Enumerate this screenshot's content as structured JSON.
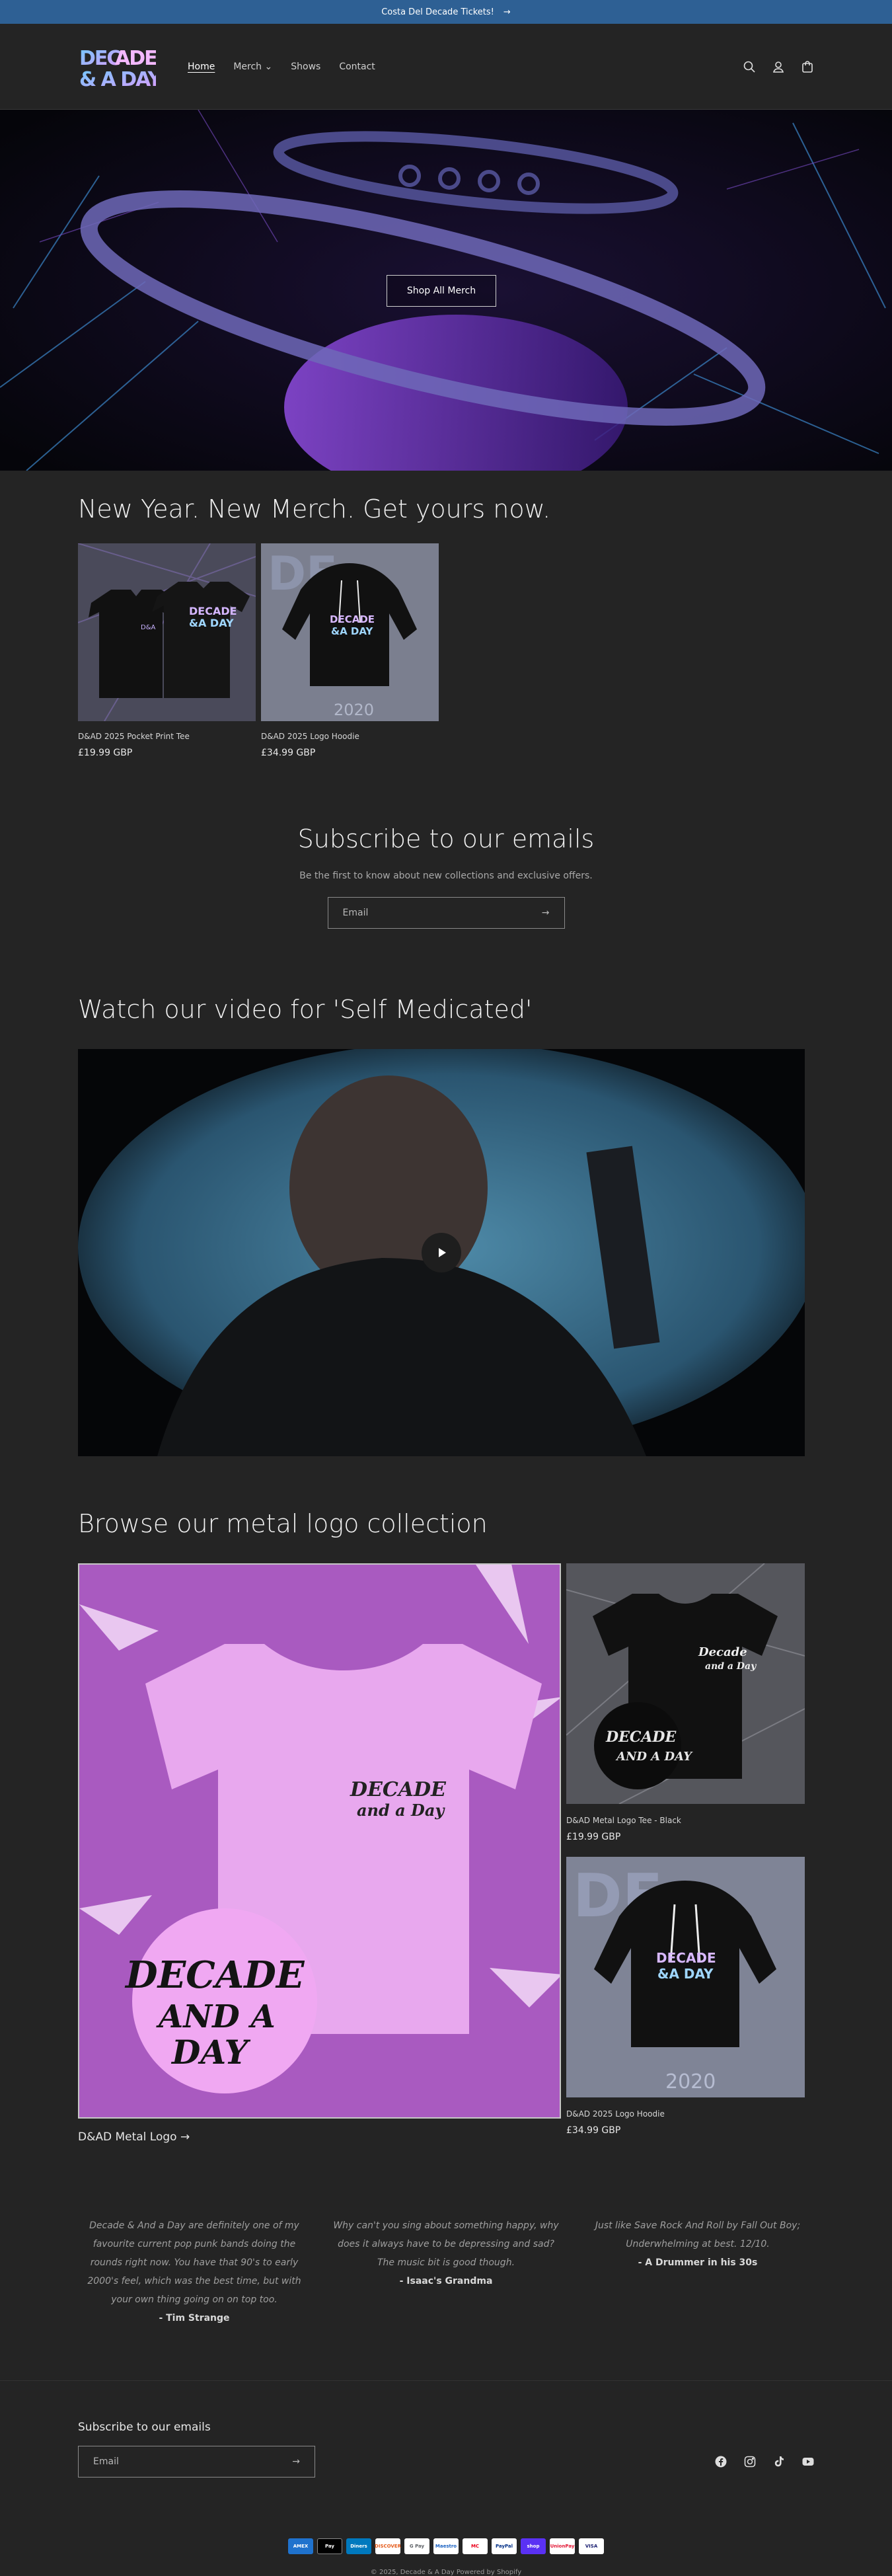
{
  "announcement": {
    "text": "Costa Del Decade Tickets!",
    "arrow": "→"
  },
  "header": {
    "logo_text": "DECADE & A DAY",
    "nav": [
      {
        "label": "Home",
        "active": true
      },
      {
        "label": "Merch",
        "has_dropdown": true
      },
      {
        "label": "Shows"
      },
      {
        "label": "Contact"
      }
    ],
    "icons": [
      "search-icon",
      "account-icon",
      "cart-icon"
    ]
  },
  "hero": {
    "button": "Shop All Merch"
  },
  "featured": {
    "heading": "New Year. New Merch. Get yours now.",
    "products": [
      {
        "title": "D&AD 2025 Pocket Print Tee",
        "price": "£19.99 GBP"
      },
      {
        "title": "D&AD 2025 Logo Hoodie",
        "price": "£34.99 GBP"
      }
    ]
  },
  "newsletter": {
    "heading": "Subscribe to our emails",
    "text": "Be the first to know about new collections and exclusive offers.",
    "placeholder": "Email"
  },
  "video": {
    "heading": "Watch our video for 'Self Medicated'"
  },
  "collection": {
    "heading": "Browse our metal logo collection",
    "big_link": "D&AD Metal Logo →",
    "products": [
      {
        "title": "D&AD Metal Logo Tee - Black",
        "price": "£19.99 GBP"
      },
      {
        "title": "D&AD 2025 Logo Hoodie",
        "price": "£34.99 GBP"
      }
    ]
  },
  "testimonials": [
    {
      "quote": "Decade & And a Day are definitely one of my favourite current pop punk bands doing the rounds right now. You have that 90's to early 2000's feel, which was the best time, but with your own thing going on on top too.",
      "author": "- Tim Strange"
    },
    {
      "quote": "Why can't you sing about something happy, why does it always have to be depressing and sad? The music bit is good though.",
      "author": "- Isaac's Grandma"
    },
    {
      "quote": "Just like Save Rock And Roll by Fall Out Boy; Underwhelming at best. 12/10.",
      "author": "- A Drummer in his 30s"
    }
  ],
  "footer": {
    "subscribe_heading": "Subscribe to our emails",
    "placeholder": "Email",
    "social": [
      "facebook-icon",
      "instagram-icon",
      "tiktok-icon",
      "youtube-icon"
    ],
    "payments": [
      {
        "label": "AMEX",
        "color": "#1f72cd"
      },
      {
        "label": "Pay",
        "color": "#000000"
      },
      {
        "label": "Diners",
        "color": "#0079be"
      },
      {
        "label": "DISCOVER",
        "color": "#ffffff"
      },
      {
        "label": "G Pay",
        "color": "#ffffff"
      },
      {
        "label": "Maestro",
        "color": "#ffffff"
      },
      {
        "label": "MC",
        "color": "#ffffff"
      },
      {
        "label": "PayPal",
        "color": "#ffffff"
      },
      {
        "label": "shop",
        "color": "#5a31f4"
      },
      {
        "label": "UnionPay",
        "color": "#ffffff"
      },
      {
        "label": "VISA",
        "color": "#ffffff"
      }
    ],
    "copyright": "© 2025, Decade & A Day Powered by Shopify"
  },
  "colors": {
    "background": "#242424",
    "announcement": "#2e6094",
    "accent_purple": "#8b3fd6"
  }
}
